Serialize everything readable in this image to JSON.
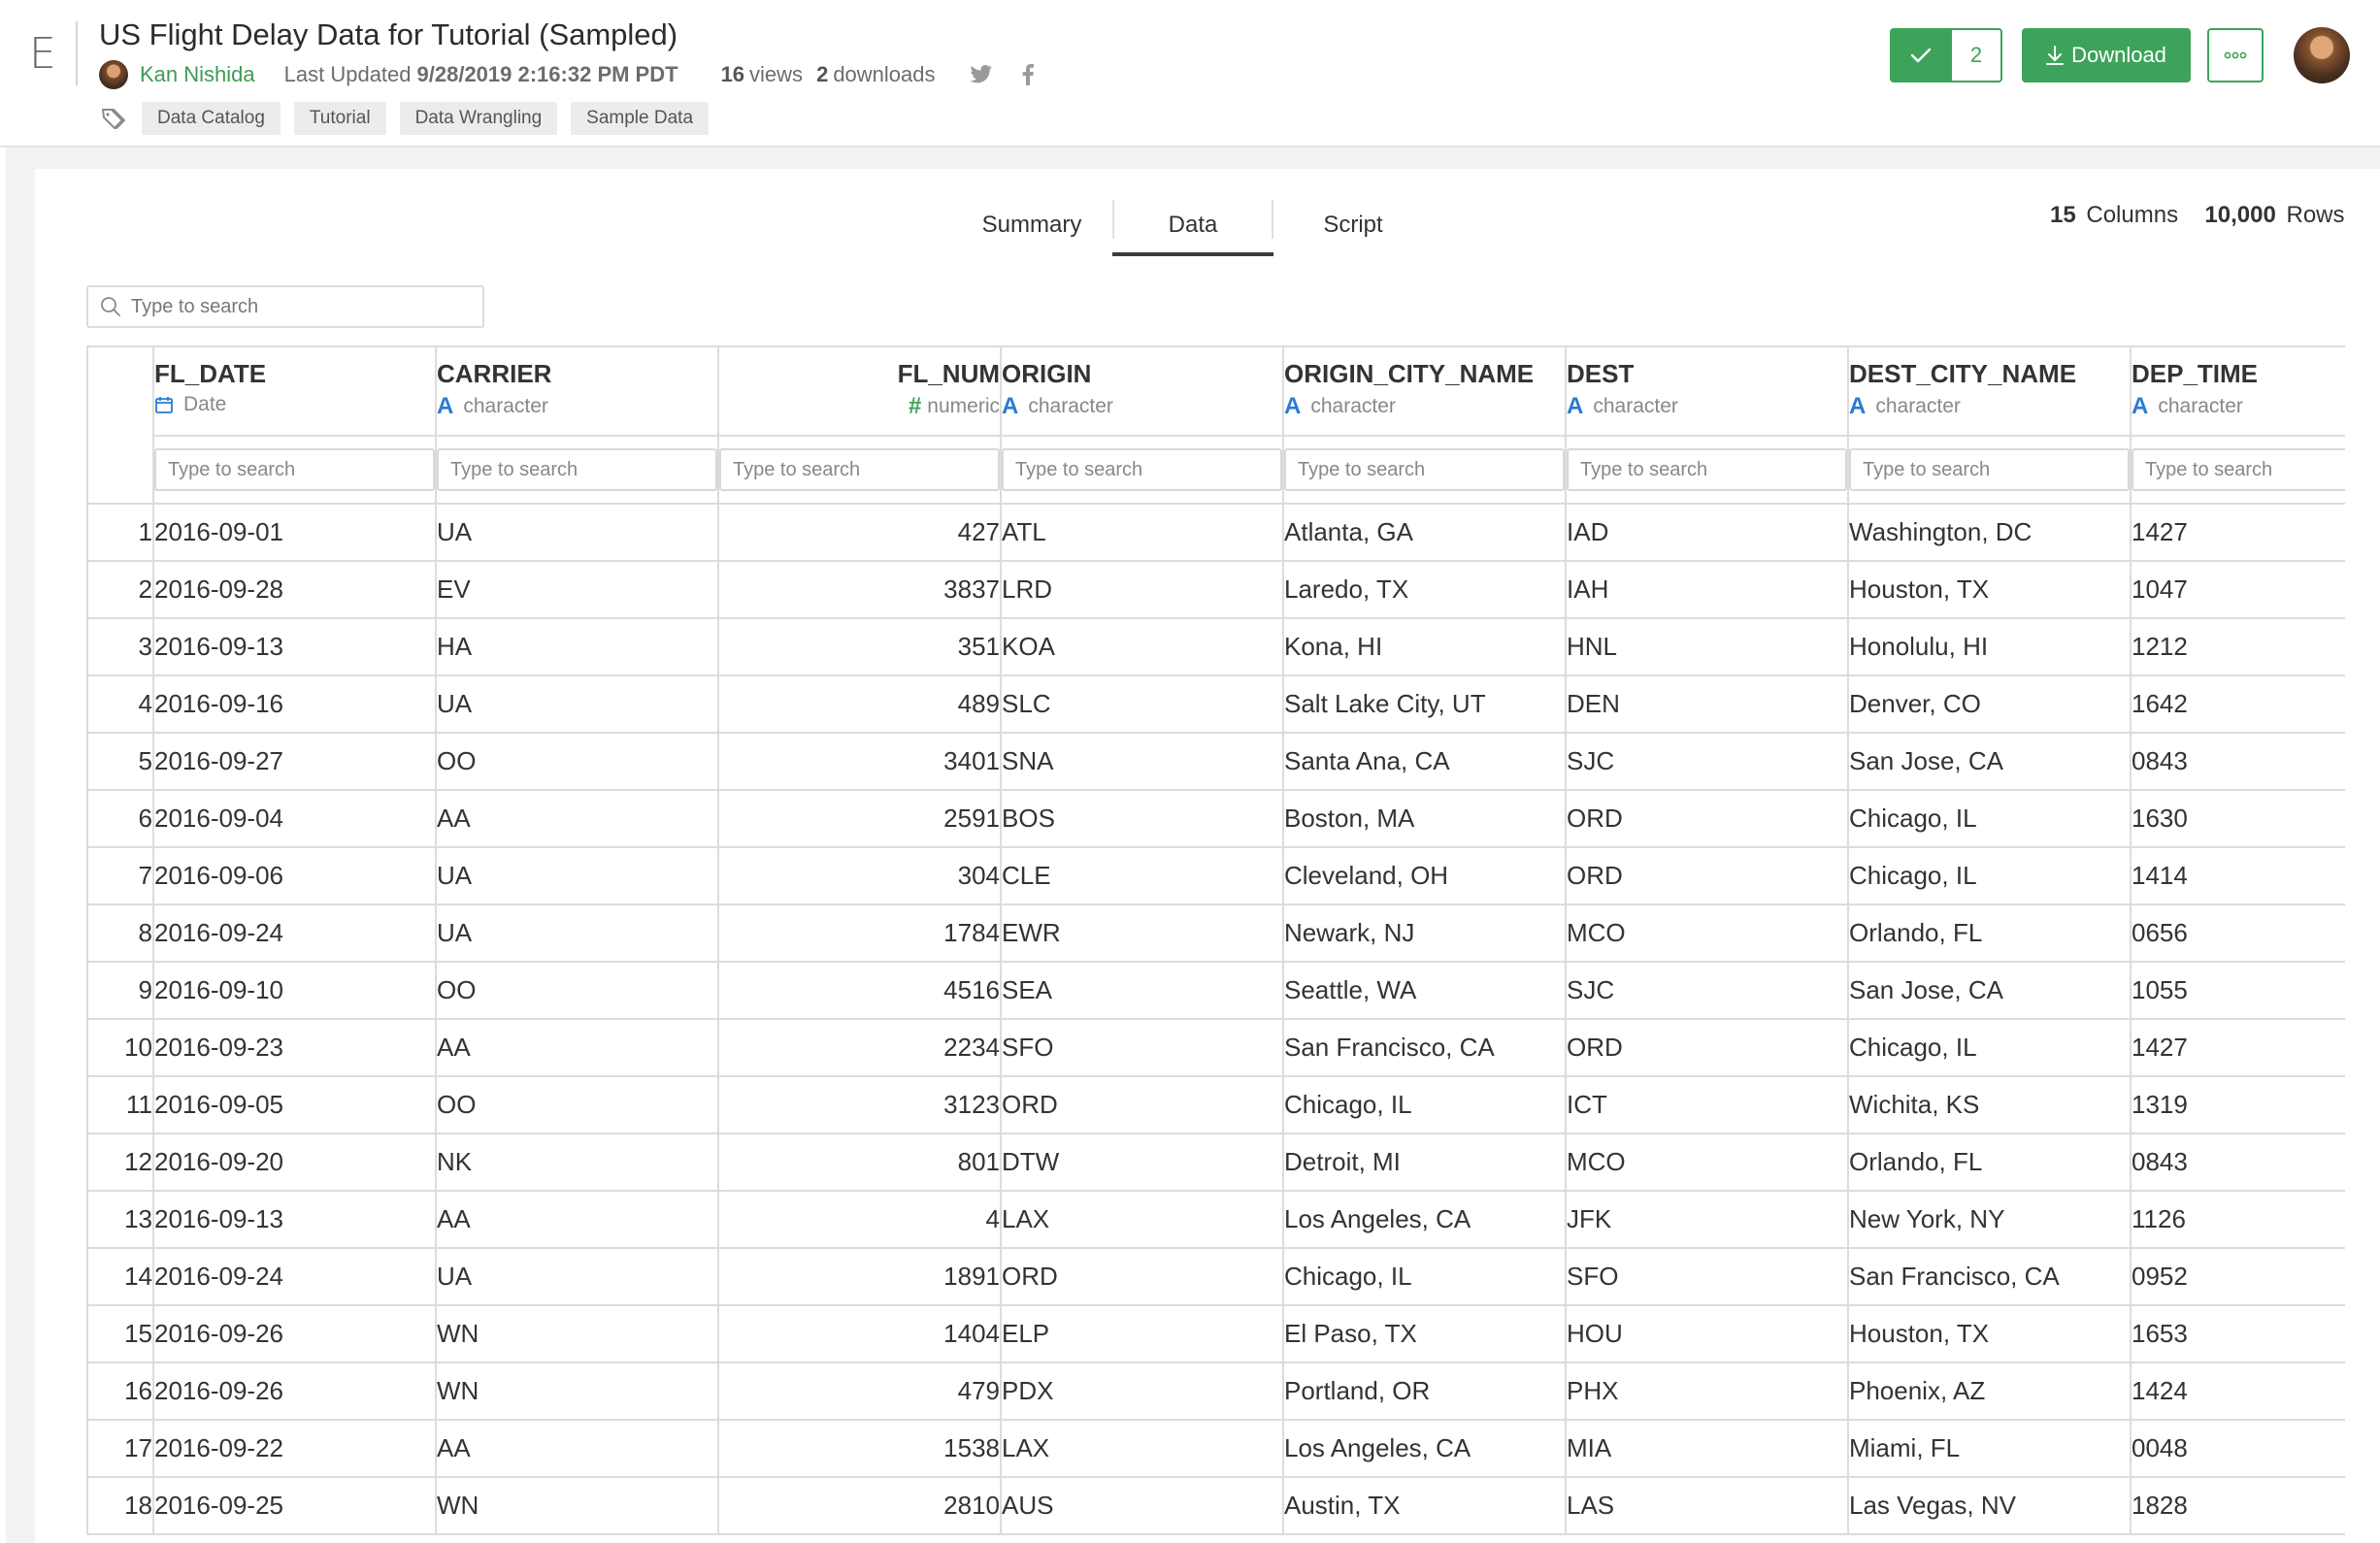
{
  "app": {
    "logo": "E"
  },
  "header": {
    "title": "US Flight Delay Data for Tutorial (Sampled)",
    "author": "Kan Nishida",
    "updated_label": "Last Updated",
    "updated_value": "9/28/2019 2:16:32 PM PDT",
    "views_count": "16",
    "views_label": "views",
    "downloads_count": "2",
    "downloads_label": "downloads",
    "social_icons": [
      "twitter-icon",
      "facebook-icon"
    ],
    "tags": [
      "Data Catalog",
      "Tutorial",
      "Data Wrangling",
      "Sample Data"
    ],
    "approve_count": "2",
    "download_label": "Download"
  },
  "colors": {
    "accent": "#3ea35a",
    "type_char": "#2a7bd4"
  },
  "tabs": [
    {
      "label": "Summary",
      "active": false
    },
    {
      "label": "Data",
      "active": true
    },
    {
      "label": "Script",
      "active": false
    }
  ],
  "counts": {
    "columns_num": "15",
    "columns_label": "Columns",
    "rows_num": "10,000",
    "rows_label": "Rows"
  },
  "search": {
    "placeholder": "Type to search"
  },
  "table": {
    "filter_placeholder": "Type to search",
    "columns": [
      {
        "name": "FL_DATE",
        "type": "Date",
        "icon": "calendar-icon"
      },
      {
        "name": "CARRIER",
        "type": "character",
        "icon": "character-type-icon"
      },
      {
        "name": "FL_NUM",
        "type": "numeric",
        "icon": "numeric-type-icon"
      },
      {
        "name": "ORIGIN",
        "type": "character",
        "icon": "character-type-icon"
      },
      {
        "name": "ORIGIN_CITY_NAME",
        "type": "character",
        "icon": "character-type-icon"
      },
      {
        "name": "DEST",
        "type": "character",
        "icon": "character-type-icon"
      },
      {
        "name": "DEST_CITY_NAME",
        "type": "character",
        "icon": "character-type-icon"
      },
      {
        "name": "DEP_TIME",
        "type": "character",
        "icon": "character-type-icon"
      }
    ],
    "rows": [
      [
        "1",
        "2016-09-01",
        "UA",
        "427",
        "ATL",
        "Atlanta, GA",
        "IAD",
        "Washington, DC",
        "1427"
      ],
      [
        "2",
        "2016-09-28",
        "EV",
        "3837",
        "LRD",
        "Laredo, TX",
        "IAH",
        "Houston, TX",
        "1047"
      ],
      [
        "3",
        "2016-09-13",
        "HA",
        "351",
        "KOA",
        "Kona, HI",
        "HNL",
        "Honolulu, HI",
        "1212"
      ],
      [
        "4",
        "2016-09-16",
        "UA",
        "489",
        "SLC",
        "Salt Lake City, UT",
        "DEN",
        "Denver, CO",
        "1642"
      ],
      [
        "5",
        "2016-09-27",
        "OO",
        "3401",
        "SNA",
        "Santa Ana, CA",
        "SJC",
        "San Jose, CA",
        "0843"
      ],
      [
        "6",
        "2016-09-04",
        "AA",
        "2591",
        "BOS",
        "Boston, MA",
        "ORD",
        "Chicago, IL",
        "1630"
      ],
      [
        "7",
        "2016-09-06",
        "UA",
        "304",
        "CLE",
        "Cleveland, OH",
        "ORD",
        "Chicago, IL",
        "1414"
      ],
      [
        "8",
        "2016-09-24",
        "UA",
        "1784",
        "EWR",
        "Newark, NJ",
        "MCO",
        "Orlando, FL",
        "0656"
      ],
      [
        "9",
        "2016-09-10",
        "OO",
        "4516",
        "SEA",
        "Seattle, WA",
        "SJC",
        "San Jose, CA",
        "1055"
      ],
      [
        "10",
        "2016-09-23",
        "AA",
        "2234",
        "SFO",
        "San Francisco, CA",
        "ORD",
        "Chicago, IL",
        "1427"
      ],
      [
        "11",
        "2016-09-05",
        "OO",
        "3123",
        "ORD",
        "Chicago, IL",
        "ICT",
        "Wichita, KS",
        "1319"
      ],
      [
        "12",
        "2016-09-20",
        "NK",
        "801",
        "DTW",
        "Detroit, MI",
        "MCO",
        "Orlando, FL",
        "0843"
      ],
      [
        "13",
        "2016-09-13",
        "AA",
        "4",
        "LAX",
        "Los Angeles, CA",
        "JFK",
        "New York, NY",
        "1126"
      ],
      [
        "14",
        "2016-09-24",
        "UA",
        "1891",
        "ORD",
        "Chicago, IL",
        "SFO",
        "San Francisco, CA",
        "0952"
      ],
      [
        "15",
        "2016-09-26",
        "WN",
        "1404",
        "ELP",
        "El Paso, TX",
        "HOU",
        "Houston, TX",
        "1653"
      ],
      [
        "16",
        "2016-09-26",
        "WN",
        "479",
        "PDX",
        "Portland, OR",
        "PHX",
        "Phoenix, AZ",
        "1424"
      ],
      [
        "17",
        "2016-09-22",
        "AA",
        "1538",
        "LAX",
        "Los Angeles, CA",
        "MIA",
        "Miami, FL",
        "0048"
      ],
      [
        "18",
        "2016-09-25",
        "WN",
        "2810",
        "AUS",
        "Austin, TX",
        "LAS",
        "Las Vegas, NV",
        "1828"
      ]
    ]
  }
}
